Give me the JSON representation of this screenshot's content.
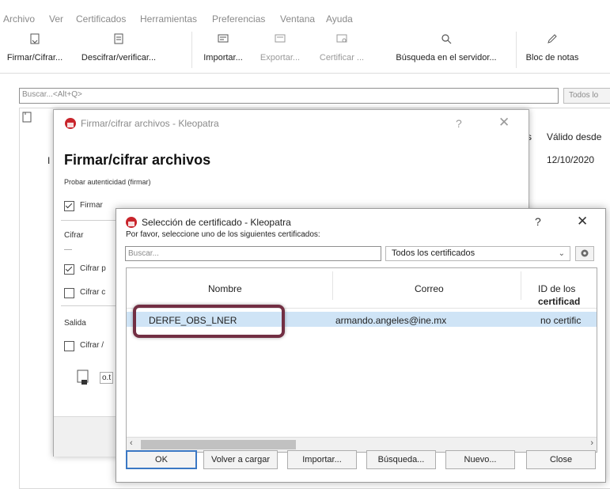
{
  "menubar": {
    "items": [
      "Archivo",
      "Ver",
      "Certificados",
      "Herramientas",
      "Preferencias",
      "Ventana",
      "Ayuda"
    ]
  },
  "toolbar": {
    "sign_encrypt": "Firmar/Cifrar...",
    "decrypt_verify": "Descifrar/verificar...",
    "import": "Importar...",
    "export": "Exportar...",
    "certify": "Certificar ...",
    "server_search": "Búsqueda en el servidor...",
    "notepad": "Bloc de notas"
  },
  "main": {
    "search_placeholder": "Buscar...<Alt+Q>",
    "filter_label": "Todos lo",
    "col_valid_from": "Válido desde",
    "col_s": "s",
    "row_date": "12/10/2020",
    "row_frag": "I"
  },
  "sign_dialog": {
    "title": "Firmar/cifrar archivos - Kleopatra",
    "help": "?",
    "close": "✕",
    "heading": "Firmar/cifrar archivos",
    "sign_section": "Probar autenticidad (firmar)",
    "sign_checkbox": "Firmar",
    "encrypt_section": "Cifrar",
    "encrypt_dash": "—",
    "encrypt_for_me": "Cifrar p",
    "encrypt_other": "Cifrar c",
    "output_section": "Salida",
    "output_checkbox": "Cifrar /",
    "output_file": "o.t"
  },
  "cert_dialog": {
    "title": "Selección de certificado - Kleopatra",
    "help": "?",
    "close": "✕",
    "prompt": "Por favor, seleccione uno de los siguientes certificados:",
    "search_placeholder": "Buscar...",
    "filter_value": "Todos los certificados",
    "columns": {
      "name": "Nombre",
      "email": "Correo",
      "id": "ID de los",
      "id_sub": "certificad"
    },
    "row": {
      "name": "DERFE_OBS_LNER",
      "email": "armando.angeles@ine.mx",
      "id": "no certific"
    },
    "buttons": {
      "ok": "OK",
      "reload": "Volver a cargar",
      "import": "Importar...",
      "search": "Búsqueda...",
      "new": "Nuevo...",
      "close": "Close"
    }
  },
  "colors": {
    "highlight": "#722f43",
    "selection": "#cfe4f6",
    "app_icon": "#c8242b"
  }
}
